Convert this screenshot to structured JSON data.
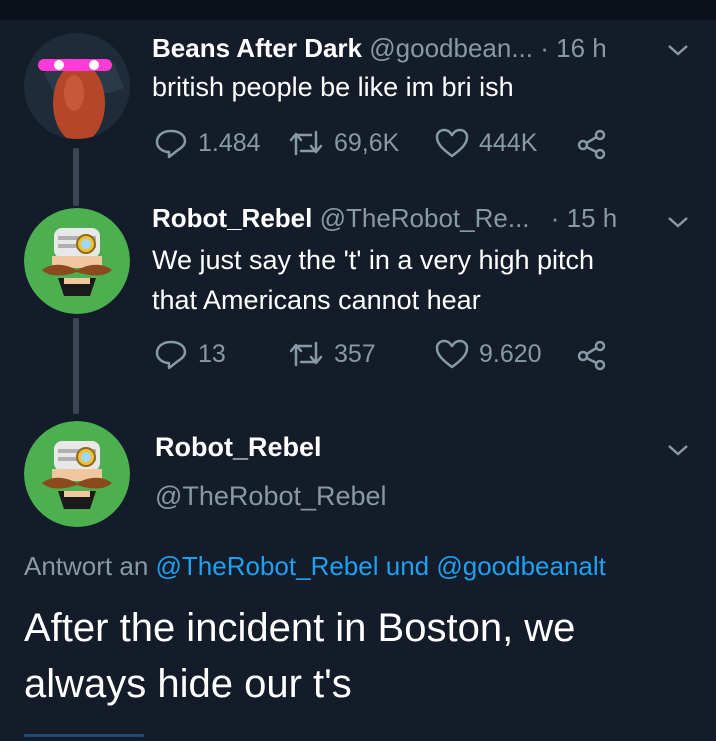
{
  "tweets": [
    {
      "name": "Beans After Dark",
      "handle": "@goodbean...",
      "time": "· 16 h",
      "text": "british people be like im bri ish",
      "replies": "1.484",
      "retweets": "69,6K",
      "likes": "444K"
    },
    {
      "name": "Robot_Rebel",
      "handle": "@TheRobot_Re...",
      "time": "· 15 h",
      "text_line1": "We just say the 't' in a very high pitch",
      "text_line2": "that Americans cannot hear",
      "replies": "13",
      "retweets": "357",
      "likes": "9.620"
    }
  ],
  "focus": {
    "name": "Robot_Rebel",
    "handle": "@TheRobot_Rebel",
    "replying_prefix": "Antwort an",
    "mention1": "@TheRobot_Rebel",
    "conjunction": "und",
    "mention2": "@goodbeanalt",
    "text_line1": "After the incident in Boston, we",
    "text_line2": "always hide our t's"
  },
  "colors": {
    "background": "#131c28",
    "secondary_text": "#8899a6",
    "link": "#1da1f2",
    "robot_avatar_bg": "#4caf50",
    "bean_avatar_body": "#b5462a"
  },
  "icons": [
    "reply-icon",
    "retweet-icon",
    "like-icon",
    "share-icon",
    "chevron-down-icon"
  ]
}
